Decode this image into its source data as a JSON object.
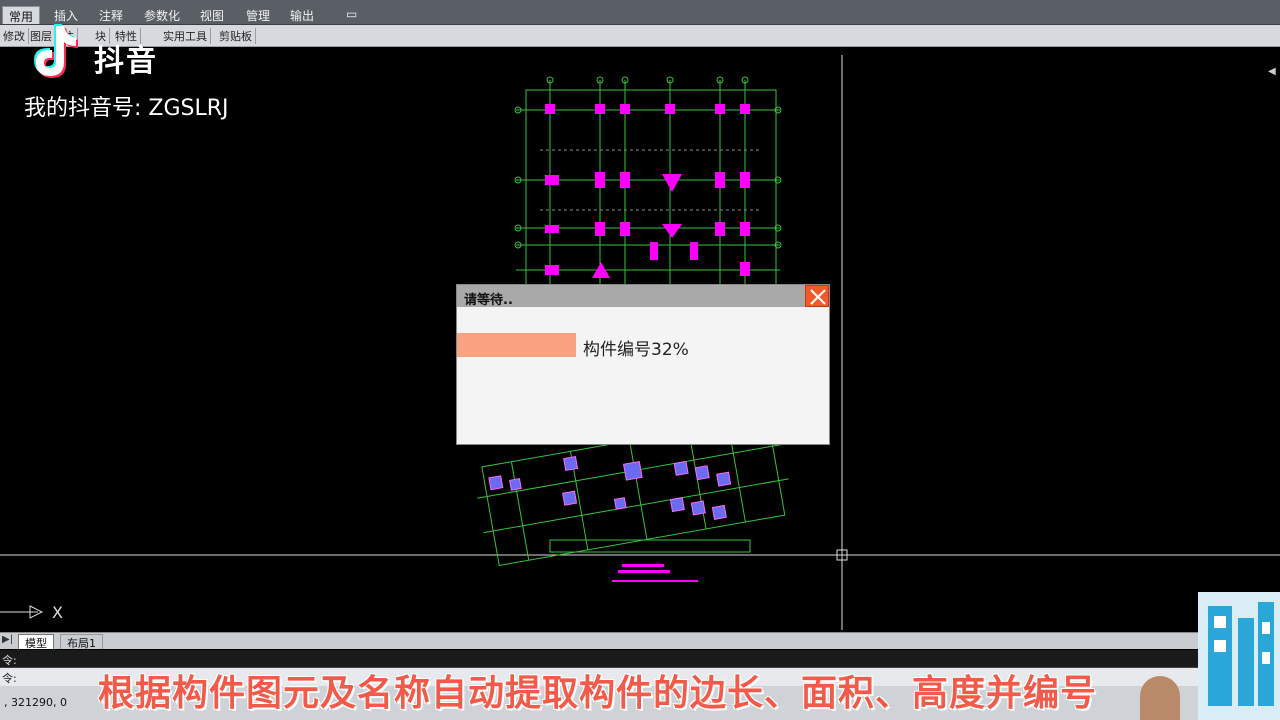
{
  "ribbon": {
    "tabs": [
      "常用",
      "插入",
      "注释",
      "参数化",
      "视图",
      "管理",
      "输出"
    ],
    "toolbar_groups": [
      "修改",
      "图层",
      "注",
      "块",
      "特性",
      "实用工具",
      "剪贴板"
    ]
  },
  "watermark": {
    "brand": "抖音",
    "account": "我的抖音号: ZGSLRJ"
  },
  "dialog": {
    "title": "请等待..",
    "label": "构件编号32%",
    "progress_percent": 32
  },
  "layout_tabs": {
    "model": "模型",
    "layout1": "布局1"
  },
  "command": {
    "line1": "令:",
    "line2": "令:"
  },
  "status": {
    "coords": ", 321290, 0"
  },
  "axis": {
    "x_label": "X"
  },
  "subtitle": "根据构件图元及名称自动提取构件的边长、面积、高度并编号",
  "colors": {
    "grid_green": "#34c43a",
    "member_magenta": "#ff00ff",
    "progress": "#f9a382",
    "close_button": "#f15b2b",
    "subtitle": "#f45a4a"
  }
}
